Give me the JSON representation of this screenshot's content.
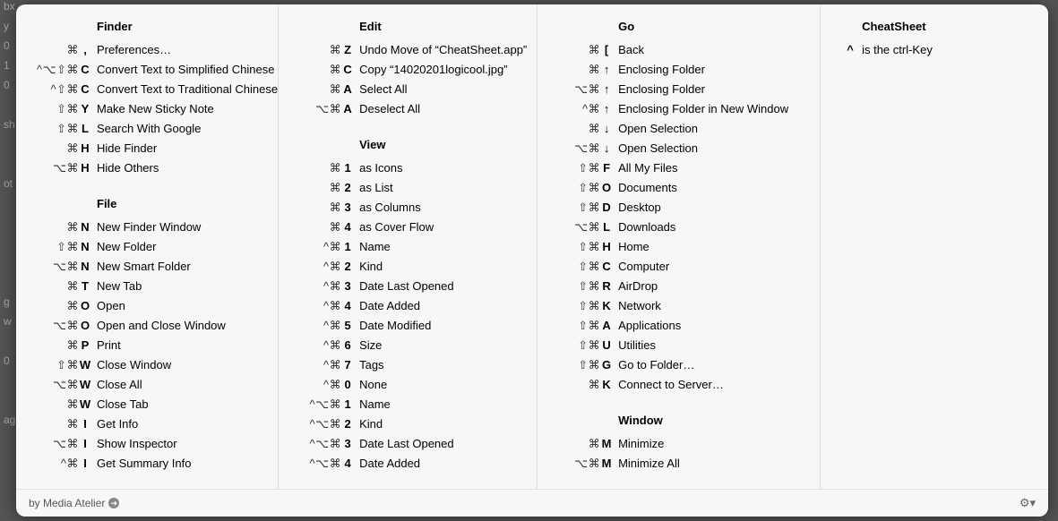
{
  "columns": [
    {
      "sections": [
        {
          "title": "Finder",
          "items": [
            {
              "keys": "⌘ ,",
              "name": "Preferences…"
            },
            {
              "keys": "^⌥⇧⌘ C",
              "name": "Convert Text to Simplified Chinese"
            },
            {
              "keys": "^⇧⌘ C",
              "name": "Convert Text to Traditional Chinese"
            },
            {
              "keys": "⇧⌘ Y",
              "name": "Make New Sticky Note"
            },
            {
              "keys": "⇧⌘ L",
              "name": "Search With Google"
            },
            {
              "keys": "⌘ H",
              "name": "Hide Finder"
            },
            {
              "keys": "⌥⌘ H",
              "name": "Hide Others"
            }
          ]
        },
        {
          "title": "File",
          "items": [
            {
              "keys": "⌘ N",
              "name": "New Finder Window"
            },
            {
              "keys": "⇧⌘ N",
              "name": "New Folder"
            },
            {
              "keys": "⌥⌘ N",
              "name": "New Smart Folder"
            },
            {
              "keys": "⌘ T",
              "name": "New Tab"
            },
            {
              "keys": "⌘ O",
              "name": "Open"
            },
            {
              "keys": "⌥⌘ O",
              "name": "Open and Close Window"
            },
            {
              "keys": "⌘ P",
              "name": "Print"
            },
            {
              "keys": "⇧⌘ W",
              "name": "Close Window"
            },
            {
              "keys": "⌥⌘ W",
              "name": "Close All"
            },
            {
              "keys": "⌘ W",
              "name": "Close Tab"
            },
            {
              "keys": "⌘ I",
              "name": "Get Info"
            },
            {
              "keys": "⌥⌘ I",
              "name": "Show Inspector"
            },
            {
              "keys": "^⌘ I",
              "name": "Get Summary Info"
            }
          ]
        }
      ]
    },
    {
      "sections": [
        {
          "title": "Edit",
          "items": [
            {
              "keys": "⌘ Z",
              "name": "Undo Move of “CheatSheet.app”"
            },
            {
              "keys": "⌘ C",
              "name": "Copy “14020201logicool.jpg”"
            },
            {
              "keys": "⌘ A",
              "name": "Select All"
            },
            {
              "keys": "⌥⌘ A",
              "name": "Deselect All"
            }
          ]
        },
        {
          "title": "View",
          "items": [
            {
              "keys": "⌘ 1",
              "name": "as Icons"
            },
            {
              "keys": "⌘ 2",
              "name": "as List"
            },
            {
              "keys": "⌘ 3",
              "name": "as Columns"
            },
            {
              "keys": "⌘ 4",
              "name": "as Cover Flow"
            },
            {
              "keys": "^⌘ 1",
              "name": "Name"
            },
            {
              "keys": "^⌘ 2",
              "name": "Kind"
            },
            {
              "keys": "^⌘ 3",
              "name": "Date Last Opened"
            },
            {
              "keys": "^⌘ 4",
              "name": "Date Added"
            },
            {
              "keys": "^⌘ 5",
              "name": "Date Modified"
            },
            {
              "keys": "^⌘ 6",
              "name": "Size"
            },
            {
              "keys": "^⌘ 7",
              "name": "Tags"
            },
            {
              "keys": "^⌘ 0",
              "name": "None"
            },
            {
              "keys": "^⌥⌘ 1",
              "name": "Name"
            },
            {
              "keys": "^⌥⌘ 2",
              "name": "Kind"
            },
            {
              "keys": "^⌥⌘ 3",
              "name": "Date Last Opened"
            },
            {
              "keys": "^⌥⌘ 4",
              "name": "Date Added"
            }
          ]
        }
      ]
    },
    {
      "sections": [
        {
          "title": "Go",
          "items": [
            {
              "keys": "⌘ [",
              "name": "Back"
            },
            {
              "keys": "⌘ ↑",
              "name": "Enclosing Folder"
            },
            {
              "keys": "⌥⌘ ↑",
              "name": "Enclosing Folder"
            },
            {
              "keys": "^⌘ ↑",
              "name": "Enclosing Folder in New Window"
            },
            {
              "keys": "⌘ ↓",
              "name": "Open Selection"
            },
            {
              "keys": "⌥⌘ ↓",
              "name": "Open Selection"
            },
            {
              "keys": "⇧⌘ F",
              "name": "All My Files"
            },
            {
              "keys": "⇧⌘ O",
              "name": "Documents"
            },
            {
              "keys": "⇧⌘ D",
              "name": "Desktop"
            },
            {
              "keys": "⌥⌘ L",
              "name": "Downloads"
            },
            {
              "keys": "⇧⌘ H",
              "name": "Home"
            },
            {
              "keys": "⇧⌘ C",
              "name": "Computer"
            },
            {
              "keys": "⇧⌘ R",
              "name": "AirDrop"
            },
            {
              "keys": "⇧⌘ K",
              "name": "Network"
            },
            {
              "keys": "⇧⌘ A",
              "name": "Applications"
            },
            {
              "keys": "⇧⌘ U",
              "name": "Utilities"
            },
            {
              "keys": "⇧⌘ G",
              "name": "Go to Folder…"
            },
            {
              "keys": "⌘ K",
              "name": "Connect to Server…"
            }
          ]
        },
        {
          "title": "Window",
          "items": [
            {
              "keys": "⌘ M",
              "name": "Minimize"
            },
            {
              "keys": "⌥⌘ M",
              "name": "Minimize All"
            }
          ]
        }
      ]
    },
    {
      "sections": [
        {
          "title": "CheatSheet",
          "items": [
            {
              "keys": "^",
              "name": "is the ctrl-Key"
            }
          ]
        }
      ]
    }
  ],
  "footer": {
    "by": "by Media Atelier"
  },
  "behind": [
    "bx",
    "y",
    "0",
    "1",
    "0",
    "",
    "sh",
    "",
    "",
    "ot",
    "",
    "",
    "",
    "",
    "",
    "g",
    "w",
    "",
    "0",
    "",
    "",
    "ag"
  ]
}
